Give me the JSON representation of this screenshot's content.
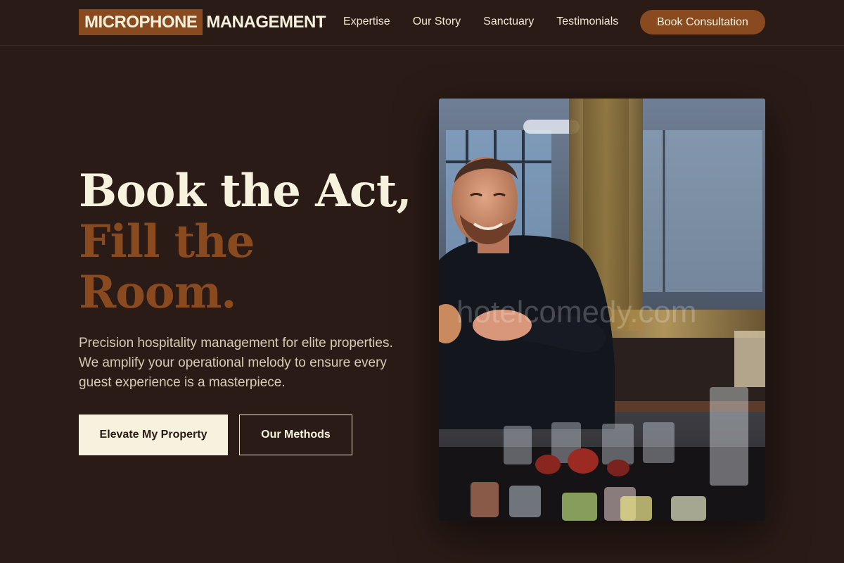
{
  "brand": {
    "logo_highlight": "MICROPHONE",
    "logo_rest": "MANAGEMENT",
    "accent_color": "#8a4a1f",
    "background_color": "#2a1b16",
    "cream_color": "#f6f2dd"
  },
  "nav": {
    "links": [
      "Expertise",
      "Our Story",
      "Sanctuary",
      "Testimonials"
    ],
    "cta_label": "Book Consultation"
  },
  "hero": {
    "headline_line1": "Book the Act,",
    "headline_line2": "Fill the",
    "headline_line3": "Room.",
    "subtext": "Precision hospitality management for elite properties. We amplify your operational melody to ensure every guest experience is a masterpiece.",
    "primary_button": "Elevate My Property",
    "secondary_button": "Our Methods",
    "image_watermark": "hotelcomedy.com"
  }
}
